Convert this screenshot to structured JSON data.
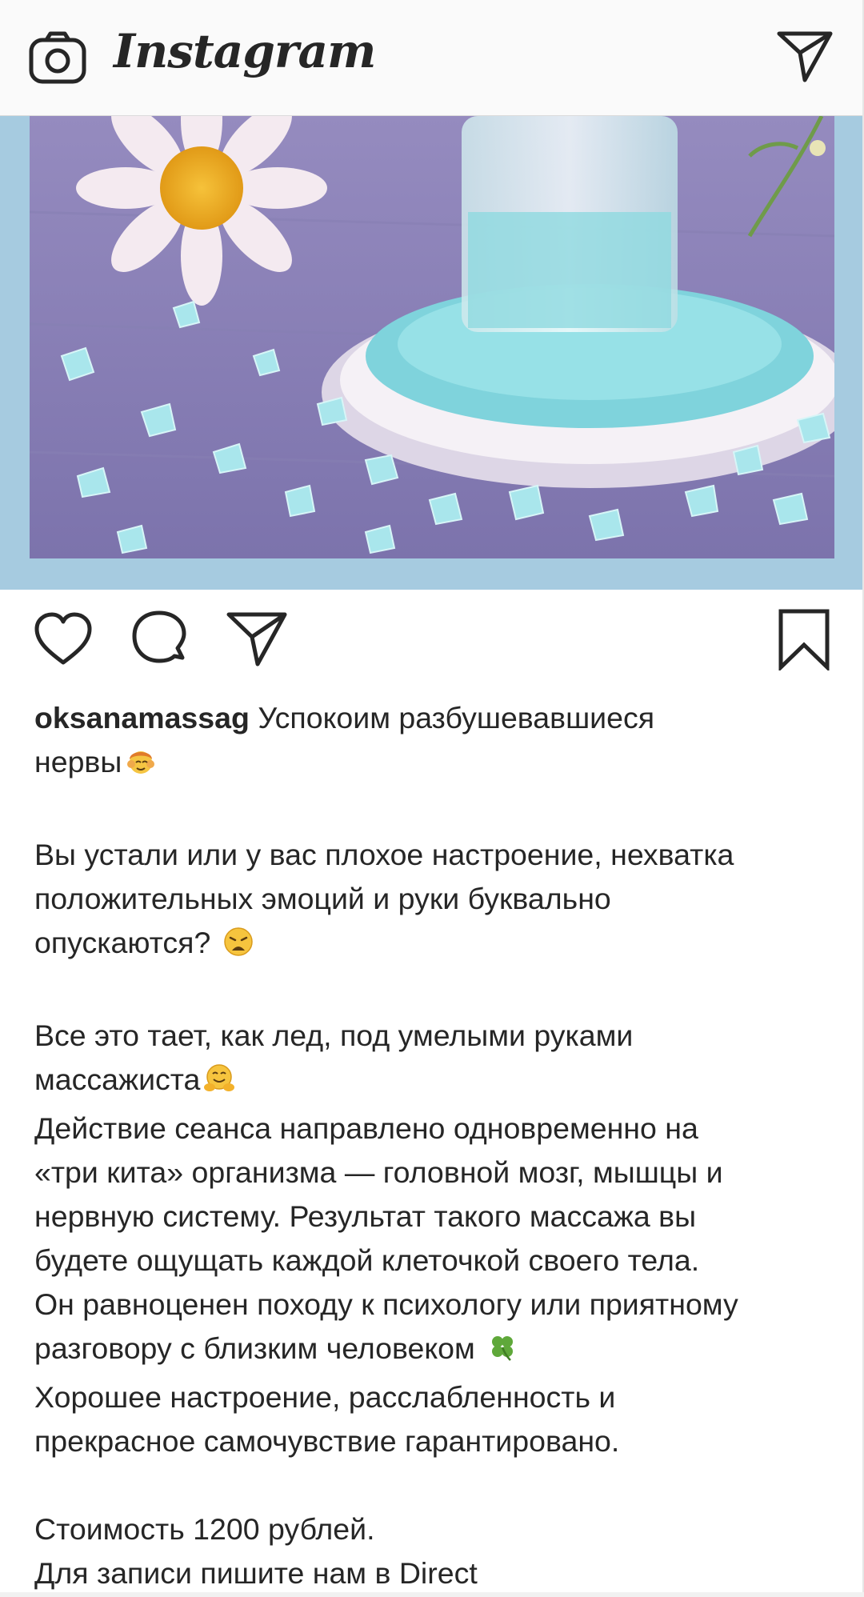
{
  "header": {
    "logo_text": "Instagram",
    "camera_icon": "camera-icon",
    "direct_icon": "paper-plane-icon"
  },
  "post": {
    "image_icon": "photo-salt-and-daisy",
    "actions": {
      "like_icon": "heart-icon",
      "comment_icon": "comment-bubble-icon",
      "share_icon": "paper-plane-icon",
      "save_icon": "bookmark-icon"
    },
    "caption": {
      "username": "oksanamassag",
      "line1": " Успокоим разбушевавшиеся",
      "line2": "нервы",
      "p1_l1": "Вы устали или у вас плохое настроение, нехватка",
      "p1_l2": "положительных эмоций и руки буквально",
      "p1_l3": "опускаются? ",
      "p2_l1": "Все это тает, как лед, под умелыми руками",
      "p2_l2": "массажиста",
      "p2_l3": "Действие сеанса направлено одновременно на",
      "p2_l4": "«три кита» организма — головной мозг, мышцы и",
      "p2_l5": "нервную систему. Результат такого массажа вы",
      "p2_l6": "будете ощущать каждой клеточкой своего тела.",
      "p2_l7": "Он равноценен походу к психологу или приятному",
      "p2_l8": "разговору с близким человеком ",
      "p2_l9": "Хорошее настроение, расслабленность и",
      "p2_l10": "прекрасное самочувствие гарантировано.",
      "p3_l1": "Стоимость 1200 рублей.",
      "p3_l2": "Для записи пишите нам в Direct"
    }
  },
  "colors": {
    "frame": "#a6cbe0",
    "text": "#262626",
    "header_bg": "#fafafa"
  }
}
